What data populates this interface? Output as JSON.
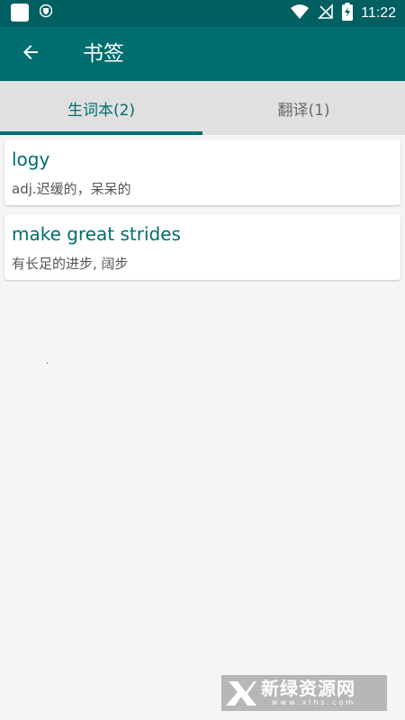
{
  "status_bar": {
    "time": "11:22",
    "icons": [
      "app-icon",
      "vpn-shield-icon",
      "wifi-icon",
      "no-sim-icon",
      "battery-charging-icon"
    ]
  },
  "toolbar": {
    "back_icon": "arrow-left-icon",
    "title": "书签"
  },
  "tabs": [
    {
      "label": "生词本(2)",
      "active": true
    },
    {
      "label": "翻译(1)",
      "active": false
    }
  ],
  "entries": [
    {
      "word": "logy",
      "definition": "adj.迟缓的，呆呆的"
    },
    {
      "word": "make great strides",
      "definition": "有长足的进步, 阔步"
    }
  ],
  "watermark": {
    "title": "新绿资源网",
    "subtitle": "www.xlhs.com"
  },
  "colors": {
    "status_bar": "#005f60",
    "toolbar": "#006d6e",
    "accent": "#006d6e",
    "tab_bar": "#e0e0e0",
    "background": "#f5f5f5"
  }
}
